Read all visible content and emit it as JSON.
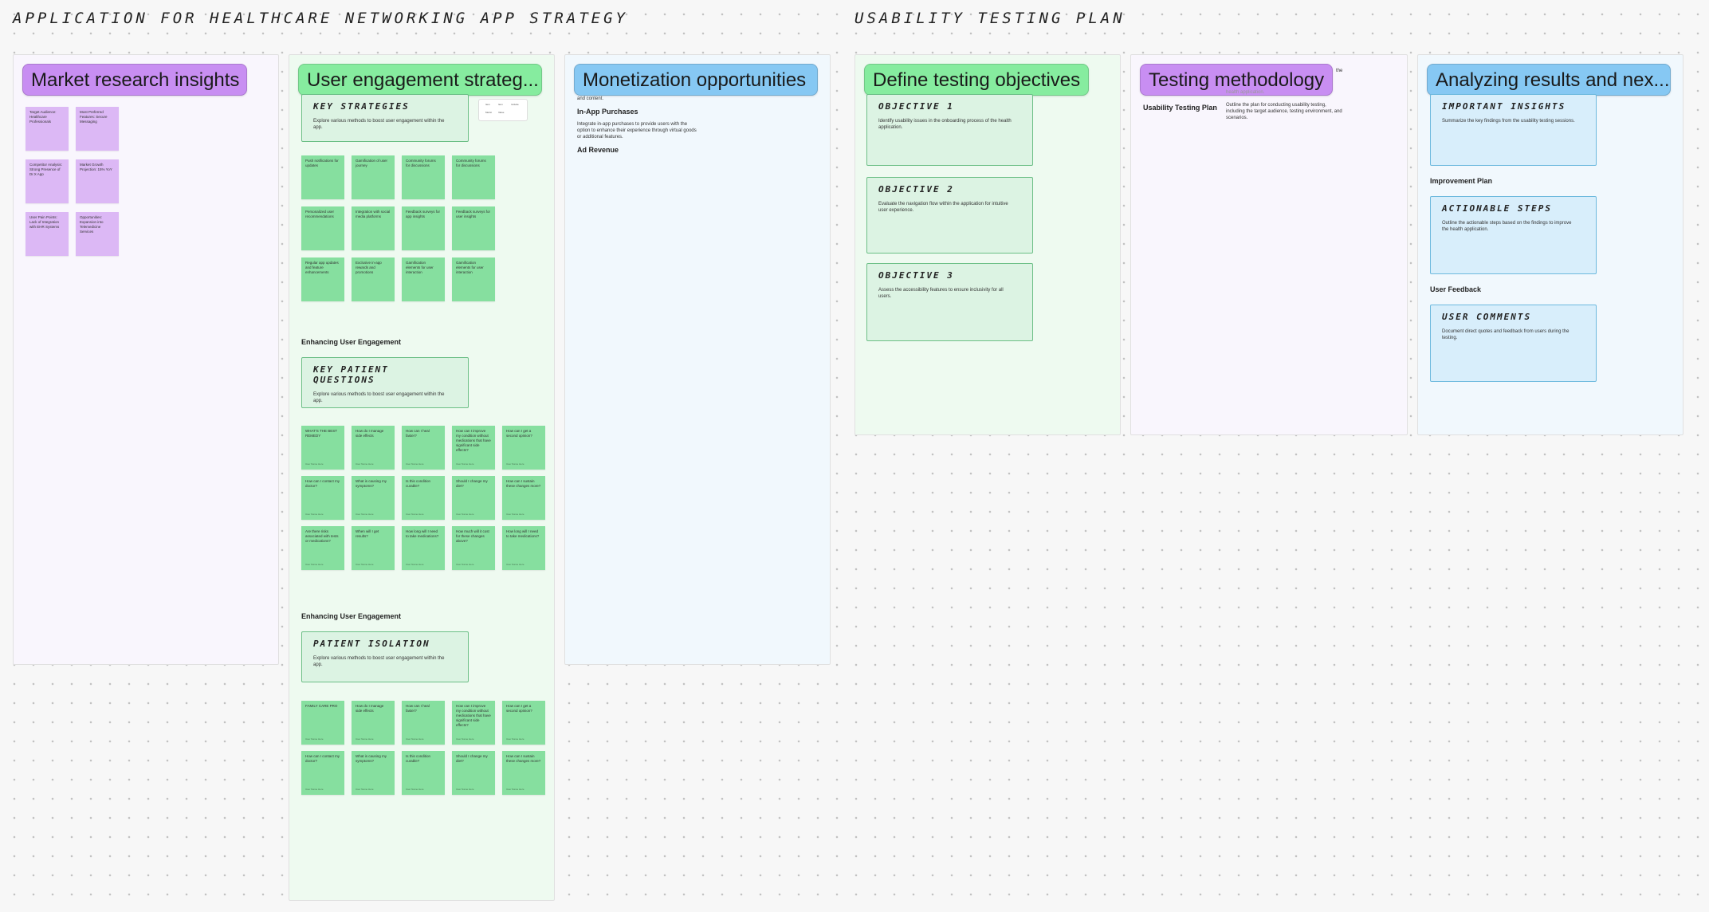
{
  "section_titles": {
    "left": "APPLICATION FOR HEALTHCARE NETWORKING APP STRATEGY",
    "right": "USABILITY TESTING PLAN"
  },
  "columns": {
    "market": {
      "title": "Market research insights",
      "stickies": [
        "Target Audience: Healthcare Professionals",
        "Most Preferred Features: Secure Messaging",
        "Competitor Analysis: Strong Presence of Dr.X App",
        "Market Growth Projection: 15% YoY",
        "User Pain Points: Lack of Integration with EHR Systems",
        "Opportunities: Expansion into Telemedicine Services"
      ]
    },
    "engagement": {
      "title": "User engagement strateg...",
      "key_strategies": {
        "title": "KEY STRATEGIES",
        "desc": "Explore various methods to boost user engagement within the app."
      },
      "mini_table": [
        "Item",
        "Item",
        "Include",
        "Metric",
        "Value"
      ],
      "strategy_stickies": [
        "Push notifications for updates",
        "Gamification of user journey",
        "Community forums for discussions",
        "Community forums for discussions",
        "Personalized user recommendations",
        "Integration with social media platforms",
        "Feedback surveys for app insights",
        "Feedback surveys for user insights",
        "Regular app updates and feature enhancements",
        "Exclusive in-app rewards and promotions",
        "Gamification elements for user interaction",
        "Gamification elements for user interaction"
      ],
      "heading1": "Enhancing User Engagement",
      "patient_questions": {
        "title": "KEY PATIENT QUESTIONS",
        "desc": "Explore various methods to boost user engagement within the app."
      },
      "question_stickies": [
        "WHAT'S THE BEST REMEDY",
        "How do I manage side effects",
        "How can I heal faster?",
        "How can I improve my condition without medications that have significant side effects?",
        "How can I get a second opinion?",
        "How can I contact my doctor?",
        "What is causing my symptoms?",
        "Is this condition curable?",
        "Should I change my diet?",
        "How can I sustain these changes more?",
        "Are there risks associated with tests or medications?",
        "When will I get results?",
        "How long will I need to take medications?",
        "How much will it cost for these changes above?",
        "How long will I need to take medications?"
      ],
      "author": "User Name Here",
      "heading2": "Enhancing User Engagement",
      "patient_isolation": {
        "title": "PATIENT ISOLATION",
        "desc": "Explore various methods to boost user engagement within the app."
      },
      "isolation_stickies": [
        "FAMILY CARE PRO",
        "How do I manage side effects",
        "How can I heal faster?",
        "How can I improve my condition without medications that have significant side effects?",
        "How can I get a second opinion?",
        "How can I contact my doctor?",
        "What is causing my symptoms?",
        "Is this condition curable?",
        "Should I change my diet?",
        "How can I sustain these changes more?"
      ]
    },
    "monetization": {
      "title": "Monetization opportunities",
      "fragment": "and content.",
      "in_app_heading": "In-App Purchases",
      "in_app_desc": "Integrate in-app purchases to provide users with the option to enhance their experience through virtual goods or additional features.",
      "ad_heading": "Ad Revenue"
    },
    "objectives": {
      "title": "Define testing objectives",
      "cards": [
        {
          "title": "OBJECTIVE 1",
          "desc": "Identify usability issues in the onboarding process of the health application."
        },
        {
          "title": "OBJECTIVE 2",
          "desc": "Evaluate the navigation flow within the application for intuitive user experience."
        },
        {
          "title": "OBJECTIVE 3",
          "desc": "Assess the accessibility features to ensure inclusivity for all users."
        }
      ]
    },
    "methodology": {
      "title": "Testing methodology",
      "fragment": "the",
      "fragment2": "health application.",
      "plan_label": "Usability Testing Plan",
      "plan_desc": "Outline the plan for conducting usability testing, including the target audience, testing environment, and scenarios."
    },
    "results": {
      "title": "Analyzing results and nex...",
      "insights": {
        "title": "IMPORTANT INSIGHTS",
        "desc": "Summarize the key findings from the usability testing sessions."
      },
      "improvement_label": "Improvement Plan",
      "steps": {
        "title": "ACTIONABLE STEPS",
        "desc": "Outline the actionable steps based on the findings to improve the health application."
      },
      "feedback_label": "User Feedback",
      "comments": {
        "title": "USER COMMENTS",
        "desc": "Document direct quotes and feedback from users during the testing."
      }
    }
  }
}
